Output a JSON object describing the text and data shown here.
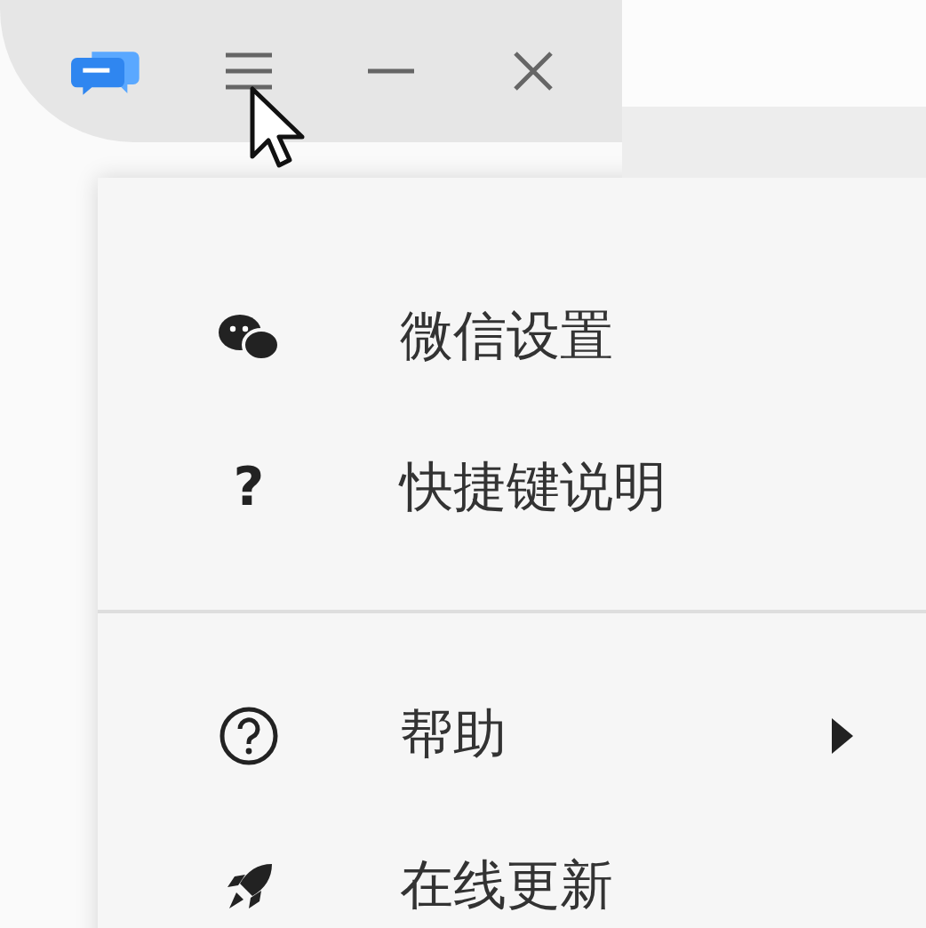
{
  "menu": {
    "sections": [
      {
        "items": [
          {
            "kind": "icon",
            "label": "微信设置",
            "has_submenu": false
          },
          {
            "kind": "glyph",
            "glyph": "?",
            "label": "快捷键说明",
            "has_submenu": false
          }
        ]
      },
      {
        "items": [
          {
            "kind": "icon",
            "label": "帮助",
            "has_submenu": true
          },
          {
            "kind": "icon",
            "label": "在线更新",
            "has_submenu": false
          }
        ]
      }
    ]
  }
}
